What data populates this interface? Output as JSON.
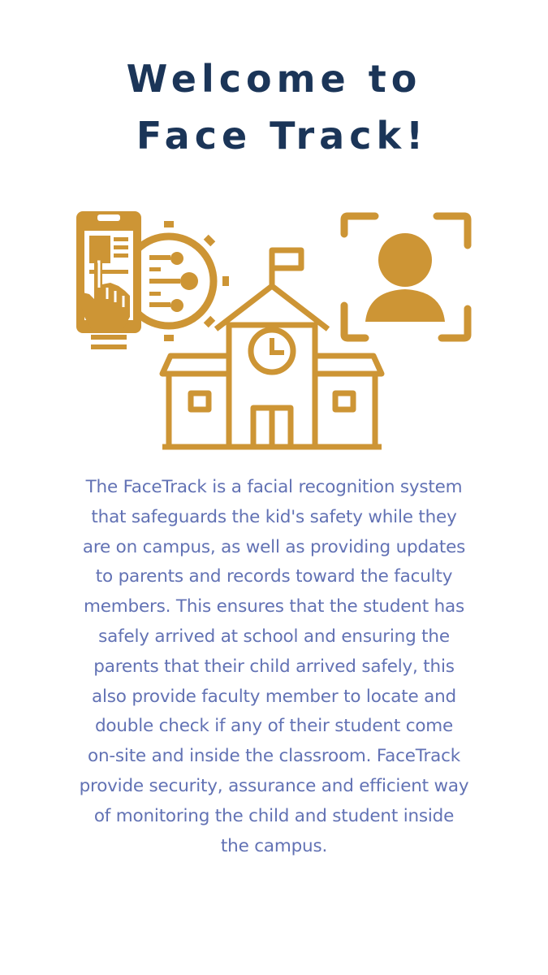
{
  "header": {
    "title_line1": "Welcome to",
    "title_line2": "Face Track!"
  },
  "illustration": {
    "icons": [
      "phone-fingerprint-icon",
      "gear-icon",
      "school-building-icon",
      "clock-icon",
      "flag-icon",
      "face-scan-user-icon"
    ],
    "color": "#cd9535"
  },
  "description": {
    "lines": [
      "The FaceTrack is a facial recognition system",
      "that safeguards the kid's safety while they",
      "are on campus, as well as providing  updates",
      "to parents and records toward the faculty",
      "members. This ensures that the student has",
      "safely arrived at school and ensuring the",
      "parents that their child arrived safely, this",
      "also provide faculty member to locate and",
      "double check if any of their student come",
      "on-site and inside the classroom. FaceTrack",
      "provide security, assurance and efficient way",
      "of monitoring the child and student inside",
      "the campus."
    ]
  },
  "colors": {
    "title": "#1b3558",
    "accent": "#cd9535",
    "body_text": "#6272b4"
  }
}
